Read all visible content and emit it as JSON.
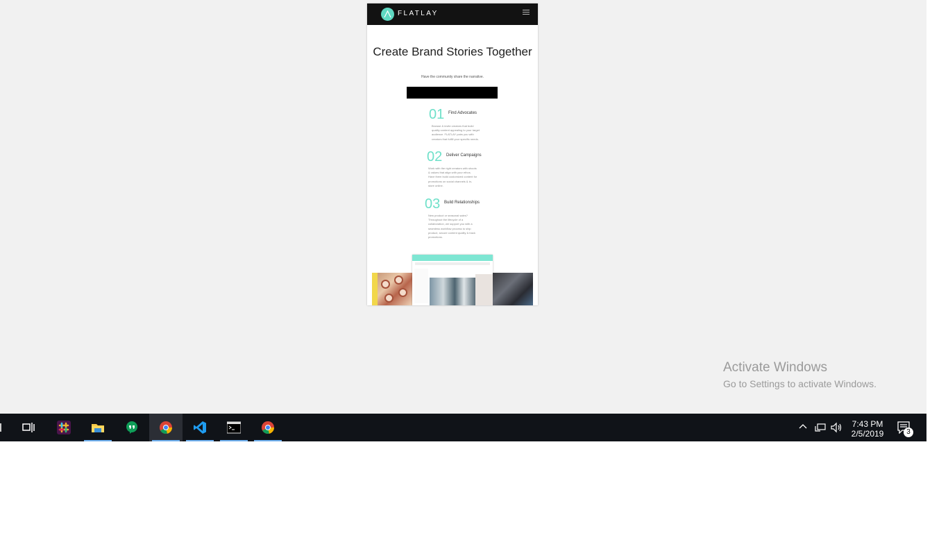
{
  "mobile": {
    "brand": "FLATLAY",
    "hero_title": "Create Brand Stories Together",
    "hero_subtitle": "Have the community share the narrative.",
    "steps": [
      {
        "number": "01",
        "title": "Find Advocates",
        "body": "Browse & invite creators that build quality content appealing to your target audience. FLATLAY pairs you with creators that fulfill your specific needs."
      },
      {
        "number": "02",
        "title": "Deliver Campaigns",
        "body": "Work with the right creators with shoots & values that align with your ethos. Have them build customized content for promotions on social channels & in-store online."
      },
      {
        "number": "03",
        "title": "Build Relationships",
        "body": "New product or seasonal sales? Throughout the lifecycle of a collaboration, we support you with a seamless workflow process to ship product, secure content quality & track promotions."
      }
    ]
  },
  "watermark": {
    "line1": "Activate Windows",
    "line2": "Go to Settings to activate Windows."
  },
  "taskbar": {
    "apps": [
      {
        "name": "task-view",
        "icon": "task-view-icon"
      },
      {
        "name": "slack",
        "icon": "slack-icon"
      },
      {
        "name": "file-explorer",
        "icon": "folder-icon"
      },
      {
        "name": "hangouts",
        "icon": "hangouts-icon"
      },
      {
        "name": "chrome",
        "icon": "chrome-icon"
      },
      {
        "name": "vscode",
        "icon": "vscode-icon"
      },
      {
        "name": "terminal",
        "icon": "terminal-icon"
      },
      {
        "name": "chrome-2",
        "icon": "chrome-icon"
      }
    ],
    "time": "7:43 PM",
    "date": "2/5/2019",
    "notification_count": "3"
  },
  "colors": {
    "accent": "#6ee0c9",
    "taskbar": "#101318",
    "header": "#121212"
  }
}
